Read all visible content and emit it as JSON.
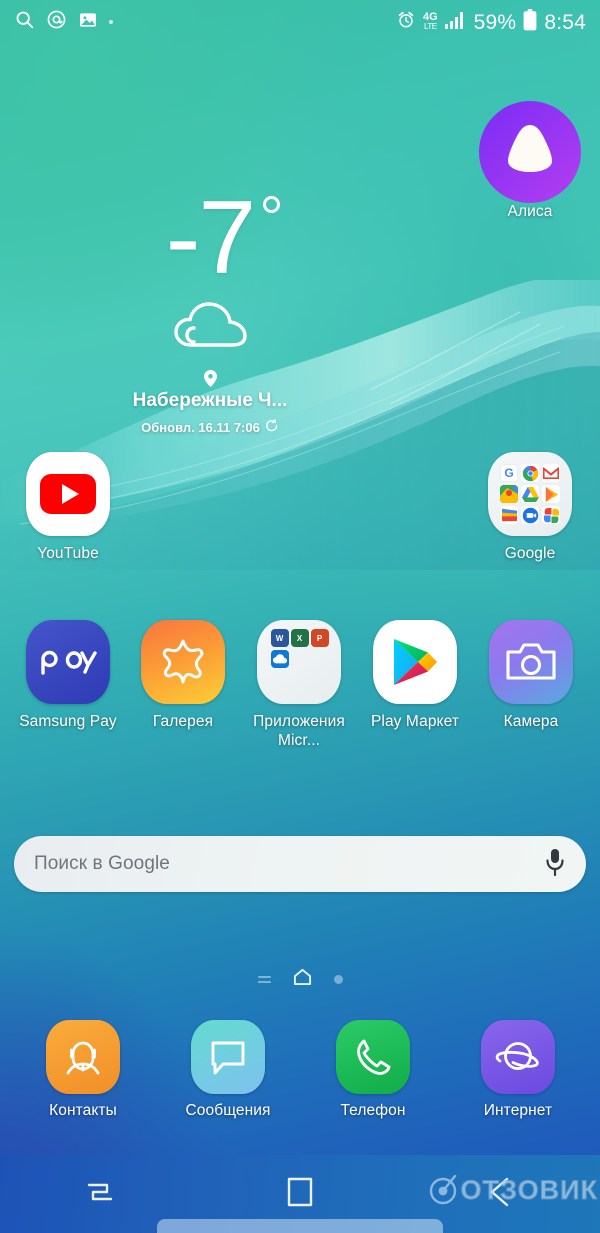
{
  "status_bar": {
    "left_icons": [
      "search-icon",
      "email-icon",
      "image-icon",
      "dot-indicator"
    ],
    "alarm_icon": "alarm-icon",
    "network_label": "4G",
    "network_sub": "LTE",
    "signal_icon": "signal-bars-icon",
    "battery_percent": "59%",
    "battery_icon": "battery-icon",
    "time": "8:54"
  },
  "weather_widget": {
    "temperature": "-7",
    "degree_symbol": "°",
    "condition_icon": "cloud-icon",
    "location_pin_icon": "location-pin-icon",
    "city": "Набережные Ч...",
    "updated": "Обновл. 16.11 7:06",
    "refresh_icon": "refresh-icon"
  },
  "widgets": [
    {
      "name": "alisa",
      "label": "Алиса",
      "icon": "alisa-icon",
      "color_start": "#7b2ff7",
      "color_end": "#a13df0"
    }
  ],
  "home_apps": [
    {
      "name": "youtube",
      "label": "YouTube",
      "icon": "youtube-icon",
      "color": "#ffffff",
      "accent": "#ff0000"
    },
    {
      "name": "google-folder",
      "label": "Google",
      "icon": "google-folder-icon",
      "folder_items": [
        "Google",
        "Chrome",
        "Gmail",
        "Maps",
        "Drive",
        "Play Music",
        "Play Movies",
        "Duo",
        "Photos"
      ]
    },
    {
      "name": "samsung-pay",
      "label": "Samsung Pay",
      "icon": "samsung-pay-icon",
      "color_start": "#3f4fc4",
      "color_end": "#2f3db6"
    },
    {
      "name": "gallery",
      "label": "Галерея",
      "icon": "gallery-icon",
      "color_start": "#f97b3d",
      "color_end": "#fdc435"
    },
    {
      "name": "microsoft-apps-folder",
      "label": "Приложения Micr...",
      "icon": "microsoft-folder-icon",
      "folder_items": [
        "Word",
        "Excel",
        "PowerPoint",
        "OneDrive"
      ]
    },
    {
      "name": "play-market",
      "label": "Play Маркет",
      "icon": "play-store-icon",
      "color": "#ffffff"
    },
    {
      "name": "camera",
      "label": "Камера",
      "icon": "camera-icon",
      "color_start": "#9b6bea",
      "color_end": "#5ea8e0"
    }
  ],
  "search": {
    "placeholder": "Поиск в Google",
    "mic_icon": "microphone-icon"
  },
  "page_indicator": {
    "left_icon": "lines-icon",
    "home_icon": "home-icon",
    "right_dot": "page-dot"
  },
  "dock_apps": [
    {
      "name": "contacts",
      "label": "Контакты",
      "icon": "contacts-icon",
      "color_start": "#f9a13a",
      "color_end": "#f08a2a"
    },
    {
      "name": "messages",
      "label": "Сообщения",
      "icon": "messages-icon",
      "color_start": "#5fd8cf",
      "color_end": "#7ab8ef"
    },
    {
      "name": "phone",
      "label": "Телефон",
      "icon": "phone-icon",
      "color_start": "#23c55e",
      "color_end": "#13b04c"
    },
    {
      "name": "internet",
      "label": "Интернет",
      "icon": "internet-icon",
      "color_start": "#7c5fe8",
      "color_end": "#6b4fe0"
    }
  ],
  "nav_bar": {
    "recents_icon": "recents-icon",
    "home_icon": "home-square-icon",
    "back_icon": "back-icon"
  },
  "watermark": {
    "text": "ОТЗОВИК",
    "logo_icon": "otzovik-logo-icon"
  },
  "colors": {
    "wallpaper_top": "#37bda6",
    "wallpaper_bottom": "#2158b8",
    "navbar": "#1f62b8"
  }
}
